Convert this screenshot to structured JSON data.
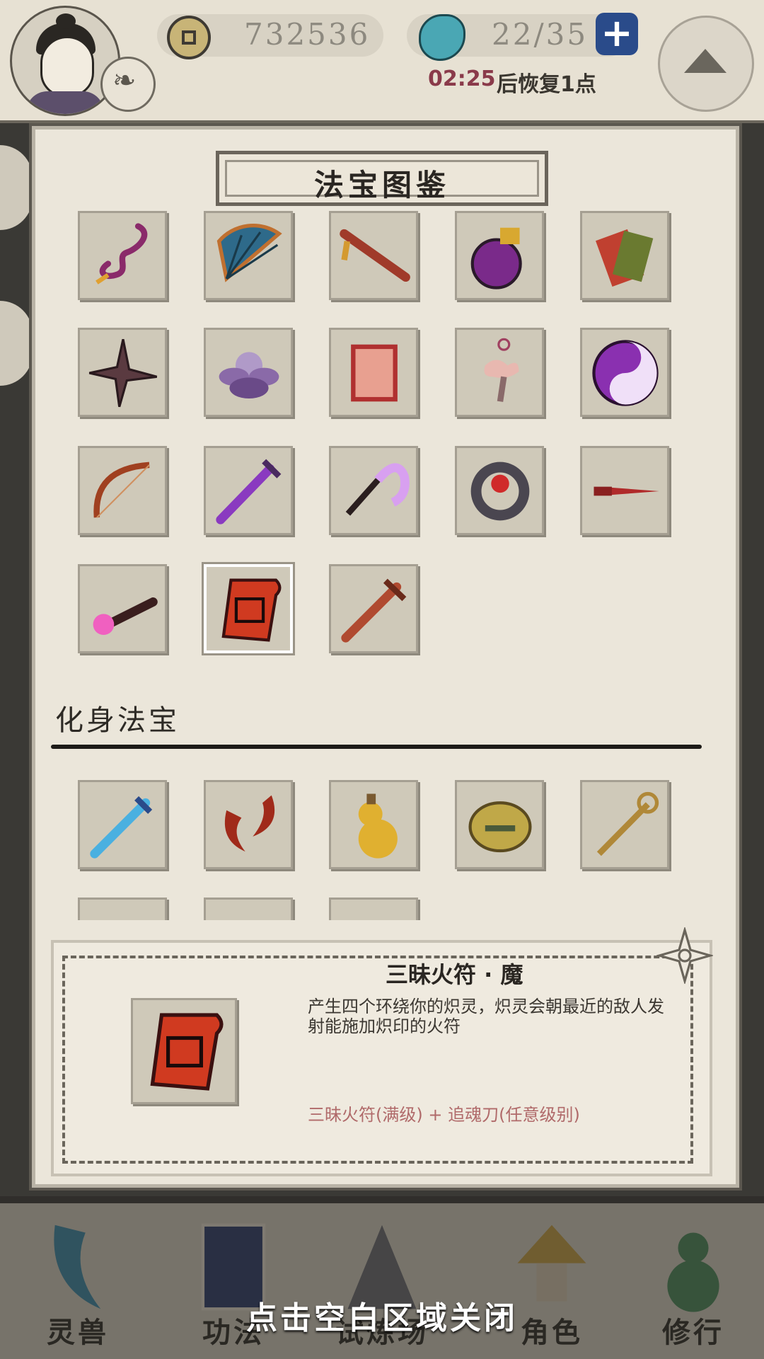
{
  "topbar": {
    "coins": "732536",
    "energy": "22/35",
    "plus_label": "+",
    "recover_time": "02:25",
    "recover_suffix": "后恢复1点"
  },
  "panel": {
    "title": "法宝图鉴",
    "section_label": "化身法宝"
  },
  "detail": {
    "name": "三昧火符 · 魔",
    "description": "产生四个环绕你的炽灵，炽灵会朝最近的敌人发射能施加炽印的火符",
    "recipe": "三昧火符(满级)  +  追魂刀(任意级别)"
  },
  "nav": {
    "items": [
      {
        "label": "灵兽",
        "icon": "feather-icon"
      },
      {
        "label": "功法",
        "icon": "book-icon"
      },
      {
        "label": "试炼场",
        "icon": "mountain-icon"
      },
      {
        "label": "角色",
        "icon": "straw-hat-icon"
      },
      {
        "label": "修行",
        "icon": "gourd-icon"
      }
    ]
  },
  "close_hint": "点击空白区域关闭",
  "colors": {
    "panel_bg": "#ebe6da",
    "cell_bg": "#cfc9b9",
    "accent_red": "#b06a6a",
    "timer_red": "#8a3a4a",
    "plus_blue": "#2a4b8a"
  }
}
